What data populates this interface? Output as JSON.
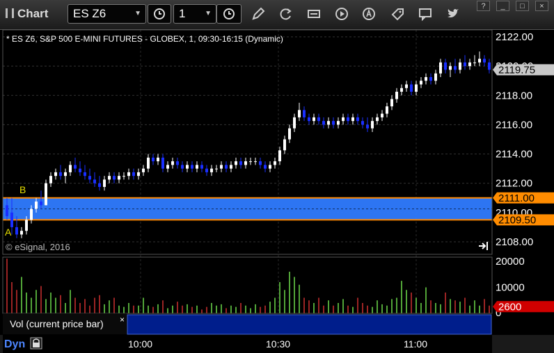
{
  "window": {
    "title": "Chart",
    "buttons": [
      "?",
      "_",
      "□",
      "×"
    ]
  },
  "toolbar": {
    "symbol": "ES Z6",
    "interval": "1",
    "icons": [
      "interval-clock-icon",
      "draw-pencil-icon",
      "refresh-icon",
      "ticker-icon",
      "play-icon",
      "alert-icon",
      "tag-icon",
      "comment-icon",
      "twitter-icon"
    ]
  },
  "chart": {
    "header": "* ES Z6, S&P 500 E-MINI FUTURES - GLOBEX, 1, 09:30-16:15 (Dynamic)",
    "watermark": "© eSignal, 2016",
    "y_ticks": [
      "2122.00",
      "2120.00",
      "2118.00",
      "2116.00",
      "2114.00",
      "2112.00",
      "2110.00",
      "2108.00"
    ],
    "price_flags": {
      "last": "2119.75",
      "upper": "2111.00",
      "lower": "2109.50"
    },
    "zone_labels": {
      "top": "B",
      "bottom": "A"
    },
    "zone_colors": {
      "fill": "#2f7bff",
      "border": "#ff8800"
    }
  },
  "volume": {
    "y_ticks": [
      "20000",
      "10000",
      "0"
    ],
    "flag": "2600",
    "study_label": "Vol (current price bar)",
    "close_label": "×"
  },
  "time_axis": {
    "labels": [
      "10:00",
      "10:30",
      "11:00"
    ],
    "mode": "Dyn"
  },
  "chart_data": {
    "type": "candlestick",
    "ylim": [
      2107.5,
      2122.5
    ],
    "candles": [
      [
        2110.5,
        2111,
        2109.5,
        2109.75
      ],
      [
        2110,
        2111,
        2108.5,
        2109
      ],
      [
        2109,
        2109.75,
        2108.25,
        2108.5
      ],
      [
        2108.5,
        2109,
        2108.25,
        2108.75
      ],
      [
        2108.75,
        2109.75,
        2108.5,
        2109.5
      ],
      [
        2109.5,
        2110.5,
        2109.25,
        2110.25
      ],
      [
        2110.25,
        2111,
        2110,
        2110.75
      ],
      [
        2110.75,
        2111.5,
        2110.25,
        2110.5
      ],
      [
        2110.5,
        2112.25,
        2110.5,
        2112
      ],
      [
        2112,
        2112.75,
        2111.75,
        2112.5
      ],
      [
        2112.5,
        2113,
        2112.25,
        2112.75
      ],
      [
        2112.75,
        2113.25,
        2112.25,
        2112.5
      ],
      [
        2112.5,
        2113,
        2112,
        2112.75
      ],
      [
        2112.75,
        2113.5,
        2112.5,
        2113.25
      ],
      [
        2113.25,
        2113.75,
        2112.75,
        2113
      ],
      [
        2113,
        2113.5,
        2112.5,
        2112.75
      ],
      [
        2112.75,
        2113.25,
        2112.25,
        2112.5
      ],
      [
        2112.5,
        2113,
        2112,
        2112.25
      ],
      [
        2112.25,
        2112.75,
        2111.75,
        2112
      ],
      [
        2112,
        2112.5,
        2111.5,
        2111.75
      ],
      [
        2111.75,
        2112.5,
        2111.5,
        2112.25
      ],
      [
        2112.25,
        2112.75,
        2112,
        2112.5
      ],
      [
        2112.5,
        2112.75,
        2112,
        2112.25
      ],
      [
        2112.25,
        2112.75,
        2112,
        2112.5
      ],
      [
        2112.5,
        2112.75,
        2112.25,
        2112.5
      ],
      [
        2112.5,
        2113,
        2112.25,
        2112.75
      ],
      [
        2112.75,
        2113,
        2112.25,
        2112.5
      ],
      [
        2112.5,
        2113,
        2112.25,
        2112.75
      ],
      [
        2112.75,
        2113.25,
        2112.5,
        2113
      ],
      [
        2113,
        2114,
        2112.75,
        2113.75
      ],
      [
        2113.75,
        2114,
        2113.25,
        2113.5
      ],
      [
        2113.5,
        2114,
        2113.25,
        2113.75
      ],
      [
        2113.75,
        2114,
        2112.75,
        2113
      ],
      [
        2113,
        2113.5,
        2112.75,
        2113.25
      ],
      [
        2113.25,
        2113.75,
        2113,
        2113.5
      ],
      [
        2113.5,
        2113.75,
        2113,
        2113.25
      ],
      [
        2113.25,
        2113.5,
        2112.75,
        2113
      ],
      [
        2113,
        2113.5,
        2112.75,
        2113.25
      ],
      [
        2113.25,
        2113.5,
        2112.75,
        2113
      ],
      [
        2113,
        2113.5,
        2112.75,
        2113.25
      ],
      [
        2113.25,
        2113.5,
        2112.75,
        2113
      ],
      [
        2113,
        2113.25,
        2112.5,
        2112.75
      ],
      [
        2112.75,
        2113.25,
        2112.5,
        2113
      ],
      [
        2113,
        2113.25,
        2112.75,
        2113
      ],
      [
        2113,
        2113.5,
        2112.75,
        2113.25
      ],
      [
        2113.25,
        2113.5,
        2112.75,
        2113
      ],
      [
        2113,
        2113.5,
        2112.75,
        2113.25
      ],
      [
        2113.25,
        2113.75,
        2113,
        2113.5
      ],
      [
        2113.5,
        2113.75,
        2113,
        2113.25
      ],
      [
        2113.25,
        2113.75,
        2113,
        2113.5
      ],
      [
        2113.5,
        2113.75,
        2113.25,
        2113.5
      ],
      [
        2113.5,
        2113.75,
        2113.25,
        2113.5
      ],
      [
        2113.5,
        2113.75,
        2113,
        2113.25
      ],
      [
        2113.25,
        2113.5,
        2112.75,
        2113
      ],
      [
        2113,
        2113.5,
        2112.75,
        2113.25
      ],
      [
        2113.25,
        2113.75,
        2113,
        2113.5
      ],
      [
        2113.5,
        2114.5,
        2113.25,
        2114.25
      ],
      [
        2114.25,
        2115.25,
        2114,
        2115
      ],
      [
        2115,
        2116,
        2114.75,
        2115.75
      ],
      [
        2115.75,
        2116.75,
        2115.5,
        2116.5
      ],
      [
        2116.5,
        2117.5,
        2116.25,
        2117
      ],
      [
        2117,
        2117.25,
        2116.25,
        2116.5
      ],
      [
        2116.5,
        2116.75,
        2116,
        2116.25
      ],
      [
        2116.25,
        2116.75,
        2116,
        2116.5
      ],
      [
        2116.5,
        2116.75,
        2116,
        2116.25
      ],
      [
        2116.25,
        2116.5,
        2115.75,
        2116
      ],
      [
        2116,
        2116.5,
        2115.75,
        2116.25
      ],
      [
        2116.25,
        2116.5,
        2115.75,
        2116
      ],
      [
        2116,
        2116.5,
        2115.75,
        2116.25
      ],
      [
        2116.25,
        2116.75,
        2116,
        2116.5
      ],
      [
        2116.5,
        2116.75,
        2116,
        2116.25
      ],
      [
        2116.25,
        2116.75,
        2116,
        2116.5
      ],
      [
        2116.5,
        2116.75,
        2116,
        2116.25
      ],
      [
        2116.25,
        2116.5,
        2115.75,
        2116
      ],
      [
        2116,
        2116.5,
        2115.5,
        2115.75
      ],
      [
        2115.75,
        2116.5,
        2115.5,
        2116.25
      ],
      [
        2116.25,
        2116.75,
        2116,
        2116.5
      ],
      [
        2116.5,
        2117,
        2116.25,
        2116.75
      ],
      [
        2116.75,
        2117.5,
        2116.5,
        2117.25
      ],
      [
        2117.25,
        2118,
        2117,
        2117.75
      ],
      [
        2117.75,
        2118.5,
        2117.5,
        2118.25
      ],
      [
        2118.25,
        2118.75,
        2118,
        2118.5
      ],
      [
        2118.5,
        2119,
        2118.25,
        2118.75
      ],
      [
        2118.75,
        2119,
        2118,
        2118.25
      ],
      [
        2118.25,
        2119,
        2118,
        2118.75
      ],
      [
        2118.75,
        2119.25,
        2118.5,
        2119
      ],
      [
        2119,
        2119.5,
        2118.75,
        2119.25
      ],
      [
        2119.25,
        2119.5,
        2118.75,
        2119
      ],
      [
        2119,
        2119.75,
        2118.75,
        2119.5
      ],
      [
        2119.5,
        2120.5,
        2119.25,
        2120.25
      ],
      [
        2120.25,
        2120.5,
        2119.5,
        2119.75
      ],
      [
        2119.75,
        2120.25,
        2119.25,
        2120
      ],
      [
        2120,
        2120.5,
        2119.5,
        2119.75
      ],
      [
        2119.75,
        2120.5,
        2119.5,
        2120.25
      ],
      [
        2120.25,
        2120.75,
        2119.75,
        2120
      ],
      [
        2120,
        2120.5,
        2119.75,
        2120.25
      ],
      [
        2120.25,
        2120.75,
        2120,
        2120.25
      ],
      [
        2120.25,
        2121,
        2120,
        2120.5
      ],
      [
        2120.5,
        2120.75,
        2120,
        2120.25
      ],
      [
        2120.25,
        2120.5,
        2119.5,
        2119.75
      ]
    ],
    "volume": [
      21000,
      12000,
      9000,
      14000,
      8000,
      6000,
      9000,
      10500,
      5500,
      8000,
      6000,
      7000,
      4000,
      9000,
      6000,
      4000,
      5500,
      3000,
      6000,
      7000,
      3500,
      5000,
      6000,
      3000,
      2500,
      4000,
      3000,
      3000,
      6000,
      3000,
      2500,
      3500,
      5000,
      2000,
      3000,
      4500,
      3000,
      3500,
      2500,
      3000,
      1500,
      2500,
      4000,
      3000,
      3500,
      2000,
      3000,
      2500,
      4000,
      3000,
      2000,
      3500,
      2500,
      3000,
      4500,
      6000,
      12000,
      9000,
      16000,
      14000,
      11000,
      6000,
      5000,
      4000,
      6000,
      3000,
      5000,
      3000,
      4000,
      5500,
      3000,
      2500,
      6000,
      4000,
      3000,
      2500,
      5000,
      3500,
      3000,
      5500,
      6000,
      12500,
      9000,
      8000,
      6000,
      4000,
      10000,
      5000,
      4000,
      3500,
      8000,
      5500,
      5000,
      4500,
      6000,
      3000,
      5000,
      3000,
      5500,
      3000
    ],
    "zone": {
      "upper": 2111.0,
      "lower": 2109.5
    }
  }
}
